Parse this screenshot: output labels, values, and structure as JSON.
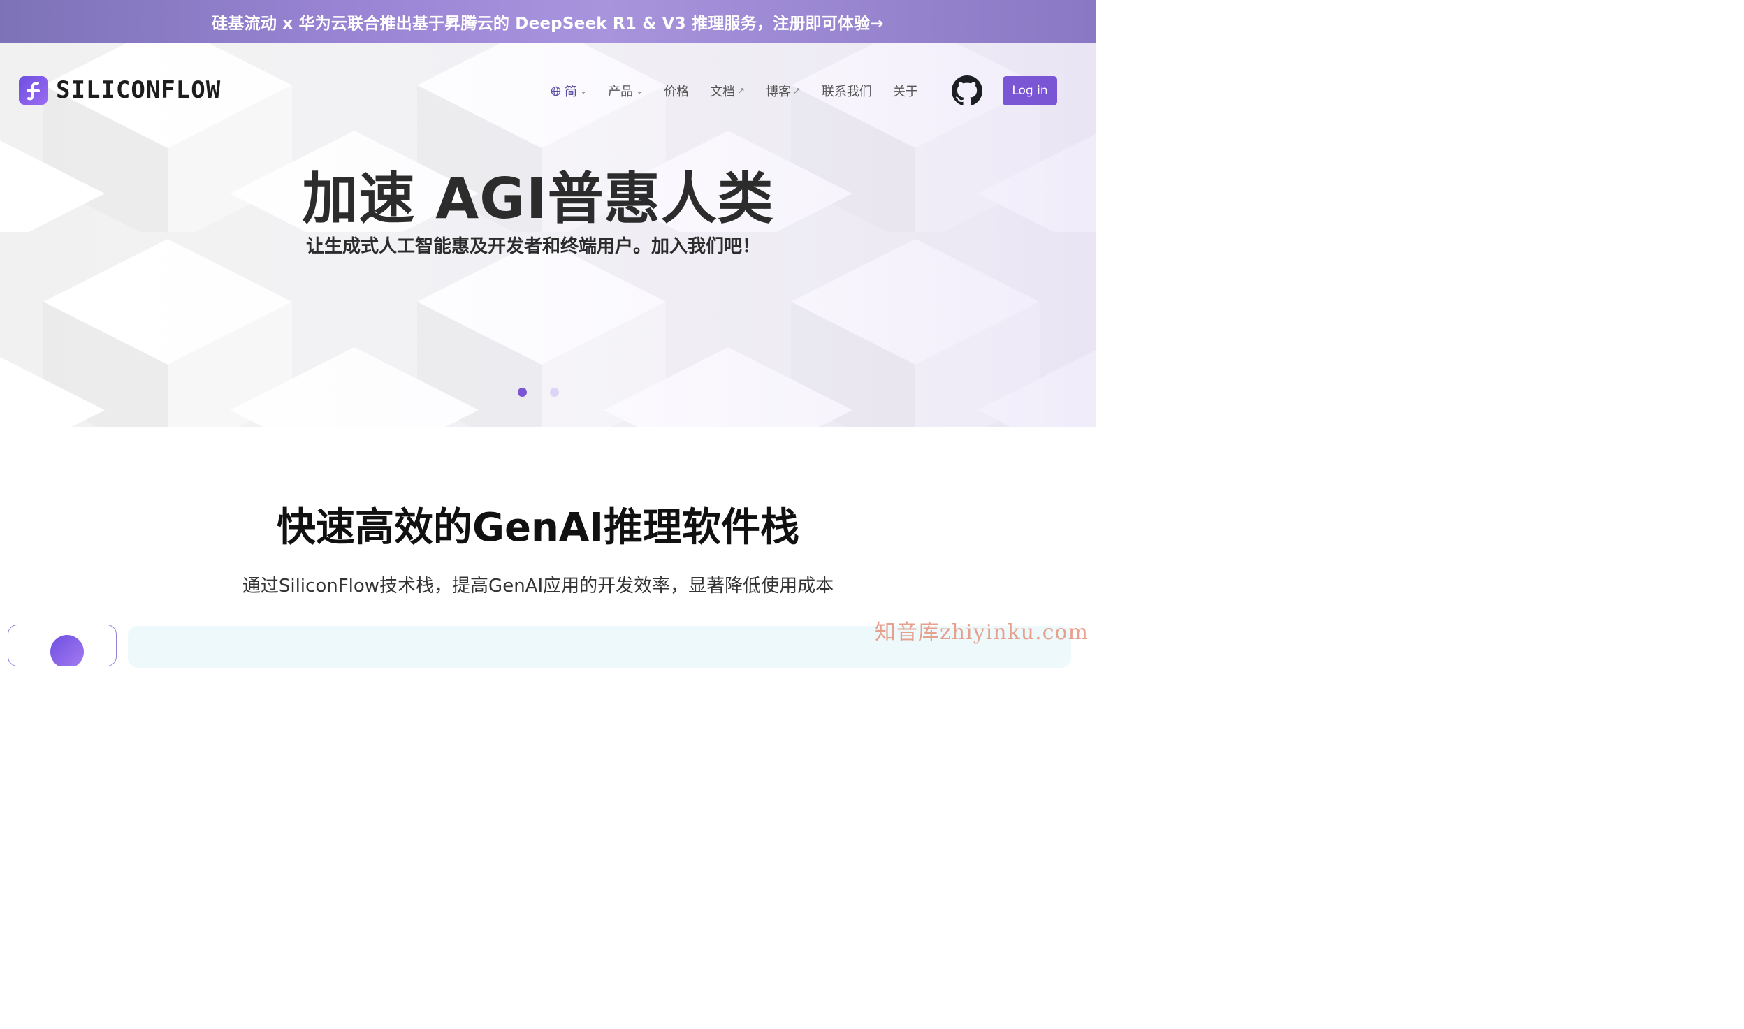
{
  "banner": {
    "text": "硅基流动 x 华为云联合推出基于昇腾云的 DeepSeek R1 & V3 推理服务，注册即可体验→"
  },
  "nav": {
    "logo_text": "SILICONFLOW",
    "items": [
      {
        "label": "简",
        "icon": "globe-icon",
        "suffix": "chevron-down"
      },
      {
        "label": "产品",
        "suffix": "chevron-down"
      },
      {
        "label": "价格"
      },
      {
        "label": "文档",
        "suffix": "external-link"
      },
      {
        "label": "博客",
        "suffix": "external-link"
      },
      {
        "label": "联系我们"
      },
      {
        "label": "关于"
      }
    ],
    "github_icon": "github-icon",
    "login_label": "Log in"
  },
  "hero": {
    "title": "加速 AGI普惠人类",
    "subtitle": "让生成式人工智能惠及开发者和终端用户。加入我们吧！",
    "slides": 2,
    "active_slide": 1
  },
  "section": {
    "title": "快速高效的GenAI推理软件栈",
    "subtitle": "通过SiliconFlow技术栈，提高GenAI应用的开发效率，显著降低使用成本"
  },
  "watermark": "知音库zhiyinku.com",
  "colors": {
    "brand": "#7a55d4",
    "banner_from": "#7d72b8",
    "banner_to": "#a894dd",
    "hero_bg": "#f1f1f2"
  }
}
